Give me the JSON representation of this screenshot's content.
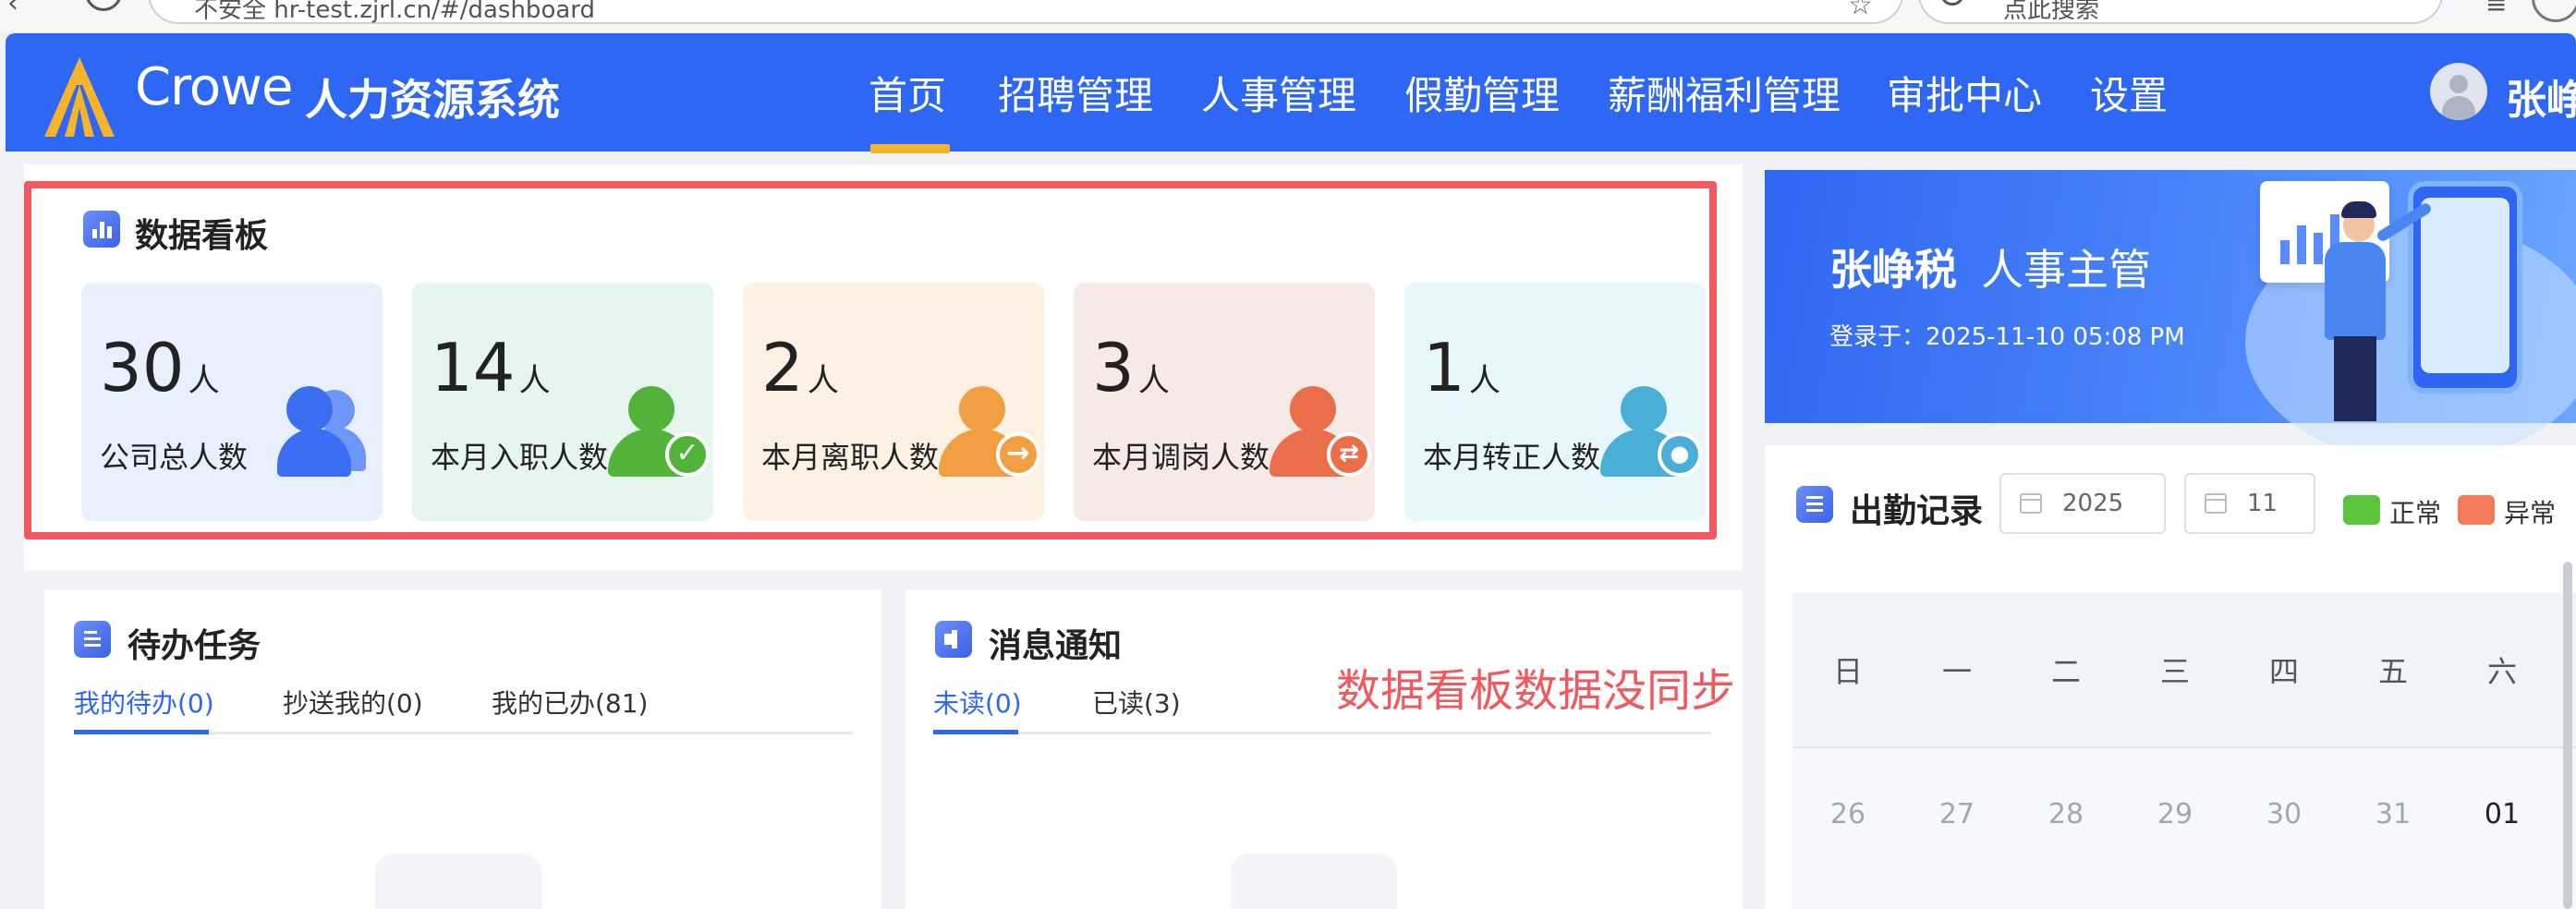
{
  "browser": {
    "url": "不安全   hr-test.zjrl.cn/#/dashboard",
    "search_placeholder": "点此搜索"
  },
  "header": {
    "logo_brand": "Crowe",
    "logo_system": "人力资源系统",
    "nav": [
      "首页",
      "招聘管理",
      "人事管理",
      "假勤管理",
      "薪酬福利管理",
      "审批中心",
      "设置"
    ],
    "active_nav": "首页",
    "user_name": "张峥税"
  },
  "dashboard": {
    "title": "数据看板",
    "stats": [
      {
        "value": "30",
        "unit": "人",
        "label": "公司总人数",
        "icon": "group-icon",
        "bg": "#e8effd",
        "color": "#3b6ef2"
      },
      {
        "value": "14",
        "unit": "人",
        "label": "本月入职人数",
        "icon": "user-check-icon",
        "bg": "#e6f5ee",
        "color": "#52b33b"
      },
      {
        "value": "2",
        "unit": "人",
        "label": "本月离职人数",
        "icon": "user-leave-icon",
        "bg": "#fdf1e3",
        "color": "#f0a043"
      },
      {
        "value": "3",
        "unit": "人",
        "label": "本月调岗人数",
        "icon": "user-transfer-icon",
        "bg": "#f7e9e6",
        "color": "#ea6e4a"
      },
      {
        "value": "1",
        "unit": "人",
        "label": "本月转正人数",
        "icon": "user-regular-icon",
        "bg": "#e8f7fc",
        "color": "#4aaed8"
      }
    ]
  },
  "todo": {
    "title": "待办任务",
    "tabs": [
      "我的待办(0)",
      "抄送我的(0)",
      "我的已办(81)"
    ]
  },
  "messages": {
    "title": "消息通知",
    "tabs": [
      "未读(0)",
      "已读(3)"
    ]
  },
  "annotation": "数据看板数据没同步",
  "profile": {
    "name": "张峥税",
    "role": "人事主管",
    "login": "登录于：2025-11-10 05:08 PM"
  },
  "attendance": {
    "title": "出勤记录",
    "year": "2025",
    "month": "11",
    "legend": [
      {
        "label": "正常",
        "color": "#5ac53a"
      },
      {
        "label": "异常",
        "color": "#f47a59"
      }
    ],
    "weekdays": [
      "日",
      "一",
      "二",
      "三",
      "四",
      "五",
      "六"
    ],
    "days": [
      "26",
      "27",
      "28",
      "29",
      "30",
      "31",
      "01"
    ]
  },
  "colors": {
    "primary": "#2e67f4",
    "active_indicator": "#f6b42b",
    "highlight": "#f05a5f"
  }
}
